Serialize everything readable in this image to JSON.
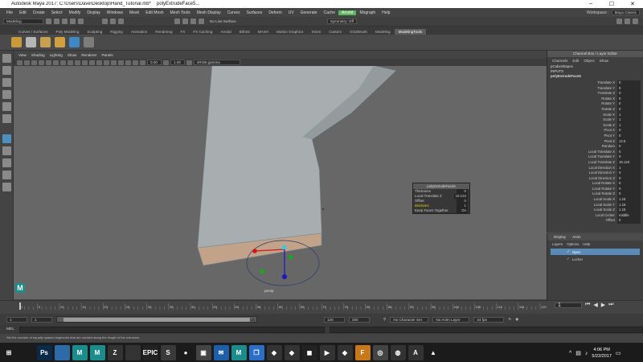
{
  "titlebar": {
    "app_title": "Autodesk Maya 2017: C:\\Users\\Dave\\Desktop\\Hand_Tutorial.mb*",
    "doc_title": "polyExtrudeFace5..."
  },
  "menubar": {
    "items": [
      "File",
      "Edit",
      "Create",
      "Select",
      "Modify",
      "Display",
      "Windows",
      "Mesh",
      "Edit Mesh",
      "Mesh Tools",
      "Mesh Display",
      "Curves",
      "Surfaces",
      "Deform",
      "UV",
      "Generate",
      "Cache",
      "Arnold",
      "Mograph",
      "Help"
    ],
    "highlight_index": 17,
    "workspace_label": "Workspace :",
    "workspace_value": "Maya Classic"
  },
  "statusline": {
    "mode": "Modeling",
    "live_surface": "No Live Surface",
    "symmetry": "Symmetry: Off"
  },
  "shelf": {
    "tabs": [
      "Curves / Surfaces",
      "Poly Modeling",
      "Sculpting",
      "Rigging",
      "Animation",
      "Rendering",
      "FX",
      "FX Caching",
      "Arnold",
      "Bifrost",
      "MASH",
      "Motion Graphics",
      "XGen",
      "Custom",
      "GOZBrush",
      "Modeling",
      "ModelingTools"
    ],
    "active_tab": "ModelingTools",
    "icon_colors": [
      "#c89a3a",
      "#b6b6b6",
      "#c8a050",
      "#d0a040",
      "#3f88c5",
      "#7d7d7d"
    ]
  },
  "panel": {
    "menu": [
      "View",
      "Shading",
      "Lighting",
      "Show",
      "Renderer",
      "Panels"
    ],
    "gamma_label": "sRGB gamma",
    "field_a": "0.00",
    "field_b": "1.00",
    "camera": "persp"
  },
  "hud": {
    "title": "polyExtrudeFace5",
    "rows": [
      {
        "label": "Thickness",
        "value": "0"
      },
      {
        "label": "Local Translate Z",
        "value": "19.123"
      },
      {
        "label": "Offset",
        "value": "0"
      },
      {
        "label": "Divisions",
        "value": "1"
      },
      {
        "label": "Keep Faces Together",
        "value": "On"
      }
    ]
  },
  "channelbox": {
    "title": "Channel Box / Layer Editor",
    "menu": [
      "Channels",
      "Edit",
      "Object",
      "Show"
    ],
    "object": "pCubeShape1",
    "inputs_label": "INPUTS",
    "input_node": "polyExtrudeFace5",
    "attributes": [
      {
        "k": "Translate X",
        "v": "0"
      },
      {
        "k": "Translate Y",
        "v": "0"
      },
      {
        "k": "Translate Z",
        "v": "0"
      },
      {
        "k": "Rotate X",
        "v": "0"
      },
      {
        "k": "Rotate Y",
        "v": "0"
      },
      {
        "k": "Rotate Z",
        "v": "0"
      },
      {
        "k": "Scale X",
        "v": "1"
      },
      {
        "k": "Scale Y",
        "v": "1"
      },
      {
        "k": "Scale Z",
        "v": "1"
      },
      {
        "k": "Pivot X",
        "v": "0"
      },
      {
        "k": "Pivot Y",
        "v": "0"
      },
      {
        "k": "Pivot Z",
        "v": "12.5"
      },
      {
        "k": "Random",
        "v": "0"
      },
      {
        "k": "Local Translate X",
        "v": "0"
      },
      {
        "k": "Local Translate Y",
        "v": "0"
      },
      {
        "k": "Local Translate Z",
        "v": "19.123"
      },
      {
        "k": "Local Direction X",
        "v": "1"
      },
      {
        "k": "Local Direction Y",
        "v": "0"
      },
      {
        "k": "Local Direction Z",
        "v": "0"
      },
      {
        "k": "Local Rotate X",
        "v": "0"
      },
      {
        "k": "Local Rotate Y",
        "v": "0"
      },
      {
        "k": "Local Rotate Z",
        "v": "0"
      },
      {
        "k": "Local Scale X",
        "v": "1.15"
      },
      {
        "k": "Local Scale Y",
        "v": "1.15"
      },
      {
        "k": "Local Scale Z",
        "v": "1.15"
      },
      {
        "k": "Local Center",
        "v": "middle"
      },
      {
        "k": "Offset",
        "v": "0"
      }
    ]
  },
  "layers": {
    "tabs": [
      "Display",
      "Anim"
    ],
    "menu": [
      "Layers",
      "Options",
      "Help"
    ],
    "rows": [
      {
        "name": "Open",
        "selected": true
      },
      {
        "name": "Locher",
        "selected": false
      }
    ]
  },
  "timeline": {
    "tick_labels": [
      "1",
      "5",
      "10",
      "15",
      "20",
      "25",
      "30",
      "35",
      "40",
      "45",
      "50",
      "55",
      "60",
      "65",
      "70",
      "75",
      "80",
      "85",
      "90",
      "95",
      "100",
      "105",
      "110",
      "115",
      "120"
    ],
    "current_frame": "1"
  },
  "range": {
    "start": "1",
    "start2": "1",
    "slider_end": "120",
    "end": "120",
    "end2": "200",
    "char_set": "No Character Set",
    "anim_layer": "No Anim Layer",
    "fps": "24 fps"
  },
  "cmdline": {
    "label": "MEL"
  },
  "help": {
    "text": "Set the number of equally spaced segments that are created along the length of the extrusion."
  },
  "taskbar": {
    "apps": [
      {
        "glyph": "⊞",
        "color": "#1b1b1b"
      },
      {
        "glyph": "",
        "color": "#1b1b1b"
      },
      {
        "glyph": "Ps",
        "color": "#0b2a4a"
      },
      {
        "glyph": "",
        "color": "#2e6aa8"
      },
      {
        "glyph": "M",
        "color": "#1c8b8b"
      },
      {
        "glyph": "M",
        "color": "#1c8b8b"
      },
      {
        "glyph": "Z",
        "color": "#333"
      },
      {
        "glyph": "",
        "color": "#333"
      },
      {
        "glyph": "EPIC",
        "color": "#222"
      },
      {
        "glyph": "S",
        "color": "#3a3a3a"
      },
      {
        "glyph": "●",
        "color": "#1b1b1b"
      },
      {
        "glyph": "▣",
        "color": "#444"
      },
      {
        "glyph": "✉",
        "color": "#1d5fa8"
      },
      {
        "glyph": "M",
        "color": "#1c8b8b"
      },
      {
        "glyph": "❒",
        "color": "#2a6ec8"
      },
      {
        "glyph": "◆",
        "color": "#333"
      },
      {
        "glyph": "◆",
        "color": "#333"
      },
      {
        "glyph": "◼",
        "color": "#222"
      },
      {
        "glyph": "▶",
        "color": "#333"
      },
      {
        "glyph": "◆",
        "color": "#333"
      },
      {
        "glyph": "F",
        "color": "#c8781a"
      },
      {
        "glyph": "◎",
        "color": "#444"
      },
      {
        "glyph": "◍",
        "color": "#333"
      },
      {
        "glyph": "A",
        "color": "#333"
      },
      {
        "glyph": "▲",
        "color": "#1b1b1b"
      }
    ],
    "time": "4:06 PM",
    "date": "5/22/2017"
  }
}
